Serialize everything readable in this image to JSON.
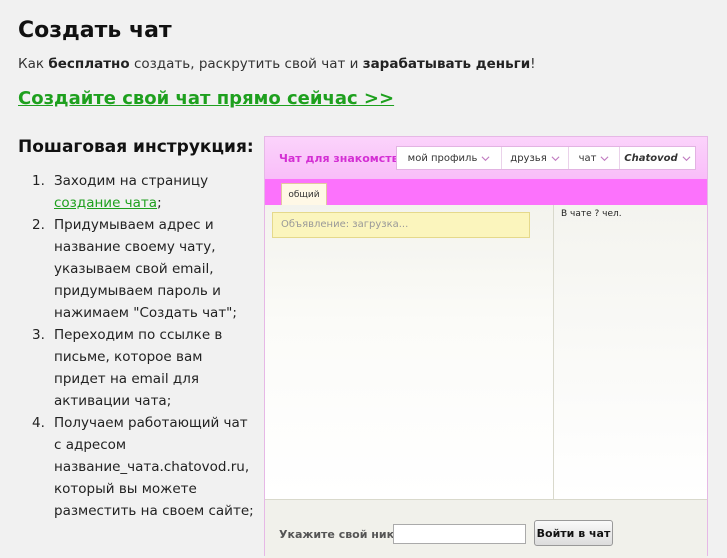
{
  "page": {
    "title": "Создать чат",
    "intro": {
      "p1": "Как ",
      "b1": "бесплатно",
      "p2": " создать, раскрутить свой чат и ",
      "b2": "зарабатывать деньги",
      "p3": "!"
    },
    "cta": "Создайте свой чат прямо сейчас >>",
    "steps_title": "Пошаговая инструкция:",
    "steps": [
      {
        "num": "1.",
        "text": "Заходим на страницу ",
        "link": "создание чата",
        "after": ";"
      },
      {
        "num": "2.",
        "text": "Придумываем адрес и название своему чату, указываем свой email, придумываем пароль и нажимаем \"Создать чат\";"
      },
      {
        "num": "3.",
        "text": "Переходим по ссылке в письме, которое вам придет на email для активации чата;"
      },
      {
        "num": "4.",
        "text": "Получаем работающий чат с адресом название_чата.chatovod.ru, который вы можете разместить на своем сайте;"
      }
    ]
  },
  "chat": {
    "name": "Чат для знакомств",
    "menu": [
      "мой профиль",
      "друзья",
      "чат"
    ],
    "brand": "Chatovod",
    "tab": "общий",
    "announcement": "Объявление: загрузка...",
    "users_count": "В чате ? чел.",
    "nick_label": "Укажите свой ник:",
    "nick_value": "",
    "login_button": "Войти в чат",
    "colors": {
      "accent": "#fc72fc",
      "link": "#1ea01e",
      "name": "#d42fd4"
    }
  }
}
